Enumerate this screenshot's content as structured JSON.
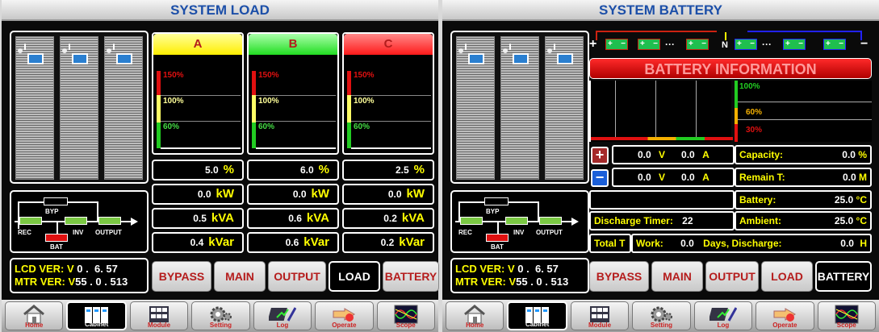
{
  "left": {
    "title": "SYSTEM LOAD",
    "flow": {
      "byp": "BYP",
      "rec": "REC",
      "inv": "INV",
      "output": "OUTPUT",
      "bat": "BAT"
    },
    "version": {
      "lcd_label": "LCD VER: V",
      "lcd_value": " 0 .  6. 57",
      "mtr_label": "MTR VER: V",
      "mtr_value": "55 . 0 . 513"
    },
    "phases": [
      {
        "name": "A",
        "color": "#ffff00",
        "marks": [
          "150%",
          "100%",
          "60%"
        ],
        "load_pct": "5.0",
        "kw": "0.0",
        "kva": "0.5",
        "kvar": "0.4"
      },
      {
        "name": "B",
        "color": "#22dd22",
        "marks": [
          "150%",
          "100%",
          "60%"
        ],
        "load_pct": "6.0",
        "kw": "0.0",
        "kva": "0.6",
        "kvar": "0.6"
      },
      {
        "name": "C",
        "color": "#ff1a1a",
        "marks": [
          "150%",
          "100%",
          "60%"
        ],
        "load_pct": "2.5",
        "kw": "0.0",
        "kva": "0.2",
        "kvar": "0.2"
      }
    ],
    "units": {
      "pct": "%",
      "kw": "kW",
      "kva": "kVA",
      "kvar": "kVar"
    },
    "tabs": [
      "BYPASS",
      "MAIN",
      "OUTPUT",
      "LOAD",
      "BATTERY"
    ],
    "selected_tab": "LOAD"
  },
  "right": {
    "title": "SYSTEM BATTERY",
    "header": "BATTERY INFORMATION",
    "marks": [
      "100%",
      "60%",
      "30%"
    ],
    "pos_row": {
      "v": "0.0",
      "v_unit": "V",
      "a": "0.0",
      "a_unit": "A"
    },
    "neg_row": {
      "v": "0.0",
      "v_unit": "V",
      "a": "0.0",
      "a_unit": "A"
    },
    "capacity": {
      "label": "Capacity:",
      "value": "0.0",
      "unit": "%"
    },
    "remain": {
      "label": "Remain T:",
      "value": "0.0",
      "unit": "M"
    },
    "battery": {
      "label": "Battery:",
      "value": "25.0",
      "unit": "°C"
    },
    "ambient": {
      "label": "Ambient:",
      "value": "25.0",
      "unit": "°C"
    },
    "discharge_timer": {
      "label": "Discharge Timer:",
      "value": "22"
    },
    "total": {
      "t": "Total T",
      "work": "Work:",
      "work_value": "0.0",
      "days": "Days, Discharge:",
      "discharge_value": "0.0",
      "unit": "H"
    },
    "tabs": [
      "BYPASS",
      "MAIN",
      "OUTPUT",
      "LOAD",
      "BATTERY"
    ],
    "selected_tab": "BATTERY"
  },
  "nav": [
    "Home",
    "Cabinet",
    "Module",
    "Setting",
    "Log",
    "Operate",
    "Scope"
  ],
  "nav_selected": "Cabinet",
  "battery_string": {
    "pos": "+",
    "neg": "−",
    "plus": "+",
    "minus": "−",
    "neutral": "N",
    "dots": "···"
  }
}
